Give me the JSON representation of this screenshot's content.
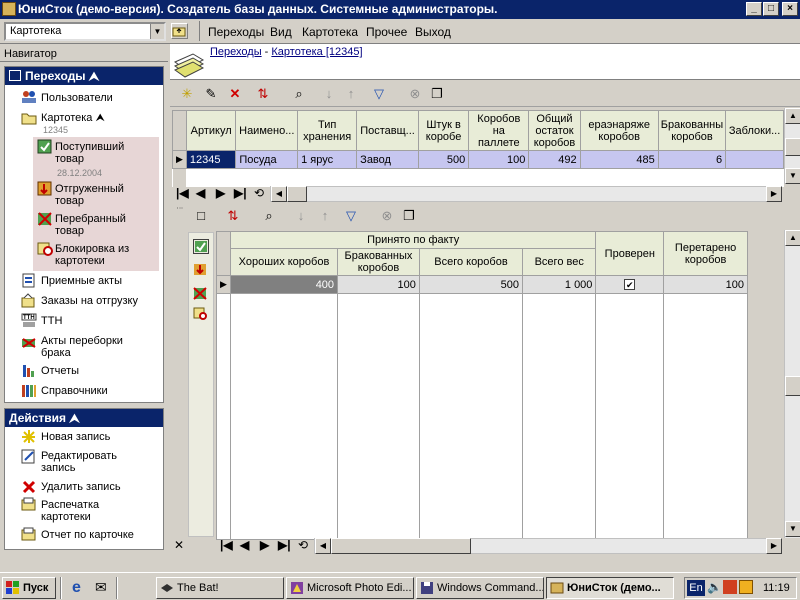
{
  "window": {
    "title": "ЮниСток (демо-версия). Создатель базы данных. Системные администраторы."
  },
  "toolbar": {
    "combo_value": "Картотека"
  },
  "menu": [
    "Переходы",
    "Вид",
    "Картотека",
    "Прочее",
    "Выход"
  ],
  "navigator": {
    "label": "Навигатор",
    "transitions_title": "Переходы",
    "items": {
      "users": "Пользователи",
      "kartoteka": "Картотека",
      "kartoteka_sub": "12345",
      "incoming": "Поступивший товар",
      "incoming_sub": "28.12.2004",
      "shipped": "Отгруженный товар",
      "sorted": "Перебранный товар",
      "block": "Блокировка из картотеки",
      "acceptance": "Приемные акты",
      "orders": "Заказы на отгрузку",
      "ttn": "ТТН",
      "sort_acts": "Акты переборки брака",
      "reports": "Отчеты",
      "references": "Справочники"
    },
    "actions_title": "Действия",
    "actions": {
      "new": "Новая запись",
      "edit": "Редактировать запись",
      "delete": "Удалить запись",
      "print": "Распечатка картотеки",
      "report": "Отчет по карточке"
    }
  },
  "breadcrumb": {
    "link1": "Переходы",
    "sep": " - ",
    "link2": "Картотека [12345]"
  },
  "top_grid": {
    "headers": [
      "Артикул",
      "Наимено...",
      "Тип хранения",
      "Поставщ...",
      "Штук в коробе",
      "Коробов на паллете",
      "Общий остаток коробов",
      "ераэнаряже коробов",
      "Бракованны коробов",
      "Заблоки..."
    ],
    "row": [
      "12345",
      "Посуда",
      "1 ярус",
      "Завод",
      "500",
      "100",
      "492",
      "485",
      "6",
      ""
    ]
  },
  "bottom_grid": {
    "group_header": "Принято по факту",
    "headers": [
      "Хороших коробов",
      "Бракованных коробов",
      "Всего коробов",
      "Всего вес",
      "Проверен",
      "Перетарено коробов"
    ],
    "row": [
      "400",
      "100",
      "500",
      "1 000",
      "✔",
      "100"
    ]
  },
  "taskbar": {
    "start": "Пуск",
    "tasks": [
      "The Bat!",
      "Microsoft Photo Edi...",
      "Windows Command...",
      "ЮниСток (демо..."
    ],
    "lang": "En",
    "clock": "11:19"
  },
  "colors": {
    "title_bg": "#0a246a",
    "selected_row": "#c6c6f0",
    "header_bg": "#e8ecd7",
    "nav_highlight": "#e7d6d6"
  }
}
